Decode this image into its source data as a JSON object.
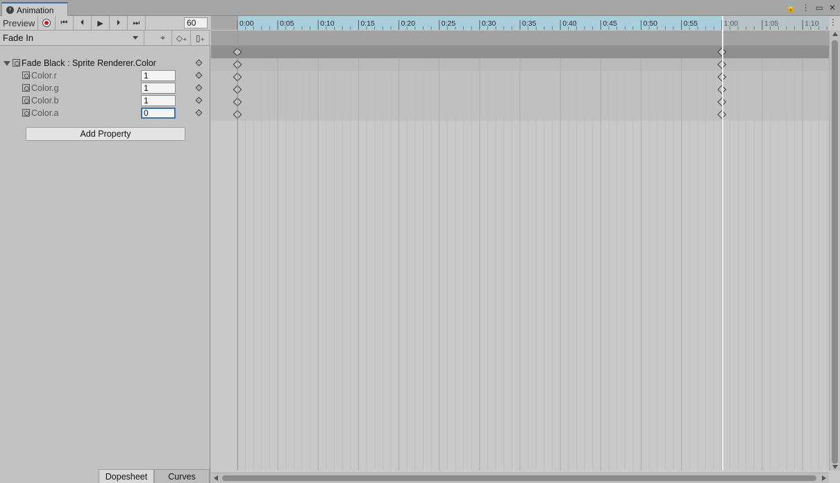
{
  "window": {
    "tab_title": "Animation",
    "tab_icon": "clock-icon",
    "buttons": [
      "lock-icon",
      "more-icon",
      "maximize-icon",
      "close-icon"
    ]
  },
  "toolbar": {
    "preview_label": "Preview",
    "record_icon": "record-icon",
    "buttons": [
      "first-key-icon",
      "prev-key-icon",
      "play-icon",
      "next-key-icon",
      "last-key-icon"
    ],
    "sample_rate": "60"
  },
  "clip": {
    "selected": "Fade In",
    "buttons": [
      "filter-icon",
      "add-keyframe-icon",
      "add-event-icon"
    ]
  },
  "properties": {
    "group": {
      "label": "Fade Black : Sprite Renderer.Color",
      "expanded": true
    },
    "items": [
      {
        "label": "Color.r",
        "value": "1"
      },
      {
        "label": "Color.g",
        "value": "1"
      },
      {
        "label": "Color.b",
        "value": "1"
      },
      {
        "label": "Color.a",
        "value": "0",
        "focused": true
      }
    ],
    "add_button": "Add Property"
  },
  "bottom_tabs": {
    "dopesheet": "Dopesheet",
    "curves": "Curves",
    "active": "Dopesheet"
  },
  "timeline": {
    "ticks": [
      "0:00",
      "0:05",
      "0:10",
      "0:15",
      "0:20",
      "0:25",
      "0:30",
      "0:35",
      "0:40",
      "0:45",
      "0:50",
      "0:55",
      "1:00",
      "1:05",
      "1:10"
    ],
    "clip_start": "0:00",
    "clip_end": "1:00",
    "keyframes_at": [
      "0:00",
      "1:00"
    ]
  },
  "colors": {
    "accent": "#3a72b0",
    "record": "#c0201d",
    "ruler_in_range": "#a9cfdc",
    "ruler_out_range": "#b7c3c7"
  }
}
